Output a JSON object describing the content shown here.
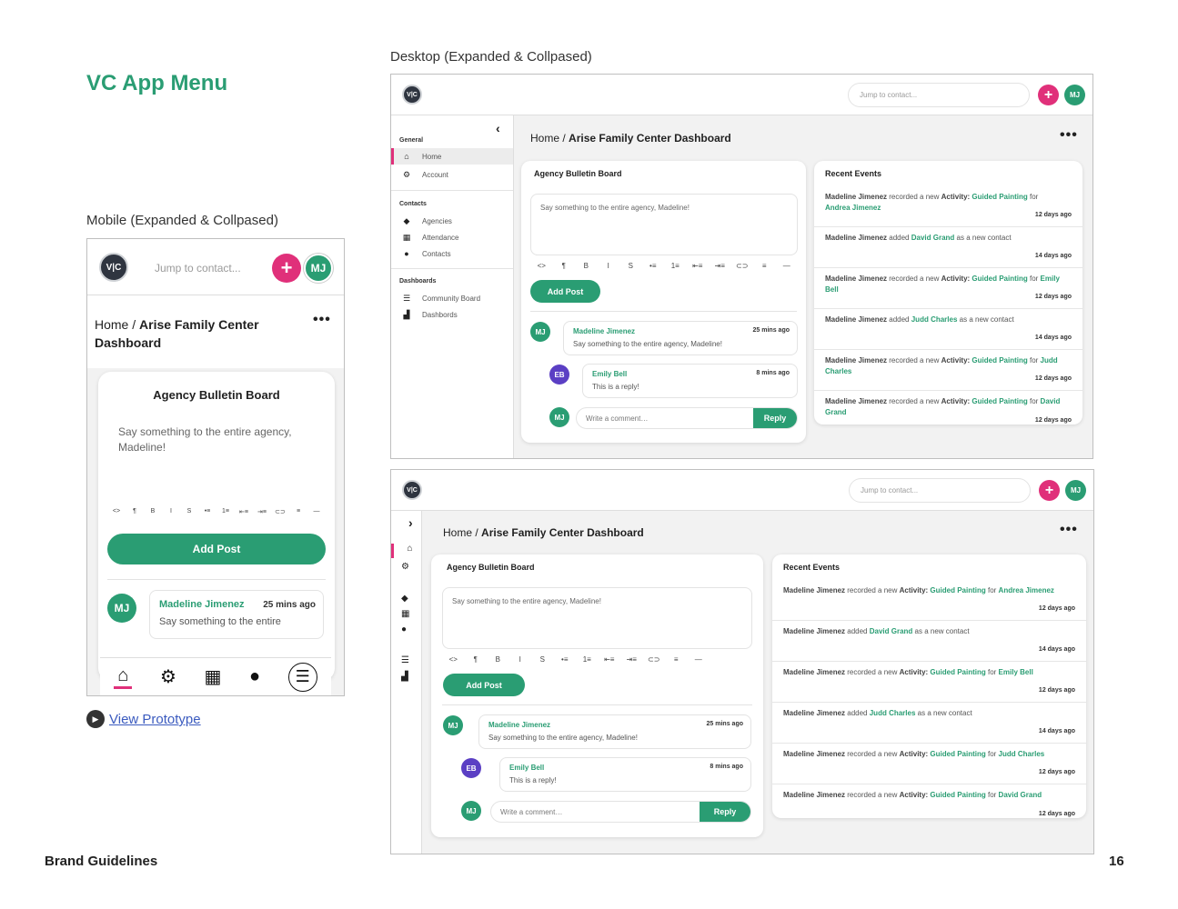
{
  "page": {
    "title": "VC App Menu",
    "mobile_label": "Mobile (Expanded & Collpased)",
    "desktop_label": "Desktop (Expanded & Collpased)",
    "prototype_link": "View Prototype",
    "footer_left": "Brand Guidelines",
    "page_number": "16"
  },
  "colors": {
    "accent": "#2a9d73",
    "pink": "#e0307a",
    "purple": "#5b3fc4",
    "dark": "#2f3540"
  },
  "app": {
    "logo": "V|C",
    "search_placeholder": "Jump to contact...",
    "add": "+",
    "user_initials": "MJ",
    "breadcrumb_home": "Home /",
    "breadcrumb_current": "Arise Family Center Dashboard",
    "more": "•••"
  },
  "sidebar": {
    "collapse_icon": "‹",
    "expand_icon": "›",
    "general_heading": "General",
    "home": "Home",
    "account": "Account",
    "contacts_heading": "Contacts",
    "agencies": "Agencies",
    "attendance": "Attendance",
    "contacts": "Contacts",
    "dashboards_heading": "Dashboards",
    "community_board": "Community Board",
    "dashboards": "Dashbords"
  },
  "bulletin": {
    "title": "Agency Bulletin Board",
    "placeholder": "Say something to the entire agency, Madeline!",
    "mobile_placeholder_l1": "Say something to the entire agency,",
    "mobile_placeholder_l2": "Madeline!",
    "add_post": "Add Post",
    "toolbar": [
      "<>",
      "¶",
      "B",
      "I",
      "S",
      "•≡",
      "1≡",
      "⇤≡",
      "⇥≡",
      "⊂⊃",
      "≡",
      "—"
    ],
    "post": {
      "author": "Madeline Jimenez",
      "time": "25 mins ago",
      "text": "Say something to the entire agency, Madeline!",
      "mobile_text": "Say something to the entire",
      "initials": "MJ"
    },
    "reply": {
      "author": "Emily Bell",
      "time": "8 mins ago",
      "text": "This is a reply!",
      "initials": "EB"
    },
    "comment_placeholder": "Write a comment…",
    "reply_button": "Reply"
  },
  "events": {
    "title": "Recent Events",
    "actor": "Madeline Jimenez",
    "recorded": "recorded a new",
    "activity_label": "Activity:",
    "activity": "Guided Painting",
    "for": "for",
    "added": "added",
    "as_contact": "as a new contact",
    "items": [
      {
        "kind": "activity",
        "target": "Andrea Jimenez",
        "ago": "12 days ago"
      },
      {
        "kind": "contact",
        "target": "David Grand",
        "ago": "14 days ago"
      },
      {
        "kind": "activity",
        "target": "Emily Bell",
        "ago": "12 days ago"
      },
      {
        "kind": "contact",
        "target": "Judd Charles",
        "ago": "14 days ago"
      },
      {
        "kind": "activity",
        "target": "Judd Charles",
        "ago": "12 days ago"
      },
      {
        "kind": "activity",
        "target": "David Grand",
        "ago": "12 days ago"
      }
    ]
  },
  "tabbar": {
    "home_icon": "home-icon",
    "account_icon": "gears-icon",
    "calendar_icon": "calendar-icon",
    "contact_icon": "person-icon",
    "menu_icon": "menu-icon"
  }
}
